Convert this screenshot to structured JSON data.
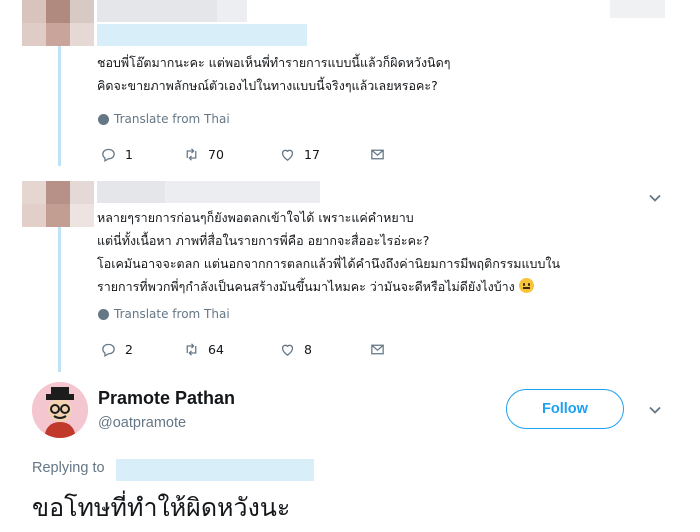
{
  "tweet1": {
    "text_lines": [
      "ชอบพี่โอ๊ตมากนะคะ แต่พอเห็นพี่ทำรายการแบบนี้แล้วก็ผิดหวังนิดๆ",
      "คิดจะขายภาพลักษณ์ตัวเองไปในทางแบบนี้จริงๆแล้วเลยหรอคะ?"
    ],
    "translate_label": "Translate from Thai",
    "replies": "1",
    "retweets": "70",
    "likes": "17"
  },
  "tweet2": {
    "text_lines": [
      "หลายๆรายการก่อนๆก็ยังพอตลกเข้าใจได้ เพราะแค่คำหยาบ",
      "แต่นี่ทั้งเนื้อหา ภาพที่สื่อในรายการพี่คือ อยากจะสื่ออะไรอ่ะคะ?",
      "โอเคมันอาจจะตลก แต่นอกจากการตลกแล้วพี่ได้คำนึงถึงค่านิยมการมีพฤติกรรมแบบใน",
      "รายการที่พวกพี่ๆกำลังเป็นคนสร้างมันขึ้นมาไหมคะ ว่ามันจะดีหรือไม่ดียังไงบ้าง"
    ],
    "emoji": "neutral-face-emoji",
    "translate_label": "Translate from Thai",
    "replies": "2",
    "retweets": "64",
    "likes": "8"
  },
  "reply": {
    "display_name": "Pramote Pathan",
    "handle": "@oatpramote",
    "follow_label": "Follow",
    "replying_label": "Replying to",
    "text": "ขอโทษที่ทำให้ผิดหวังนะ"
  },
  "colors": {
    "accent": "#1da1f2",
    "muted": "#657786",
    "thread_line": "#bfe2f5",
    "text": "#14171a"
  },
  "icons": [
    "reply-icon",
    "retweet-icon",
    "like-icon",
    "dm-icon",
    "chevron-down-icon",
    "globe-icon"
  ]
}
